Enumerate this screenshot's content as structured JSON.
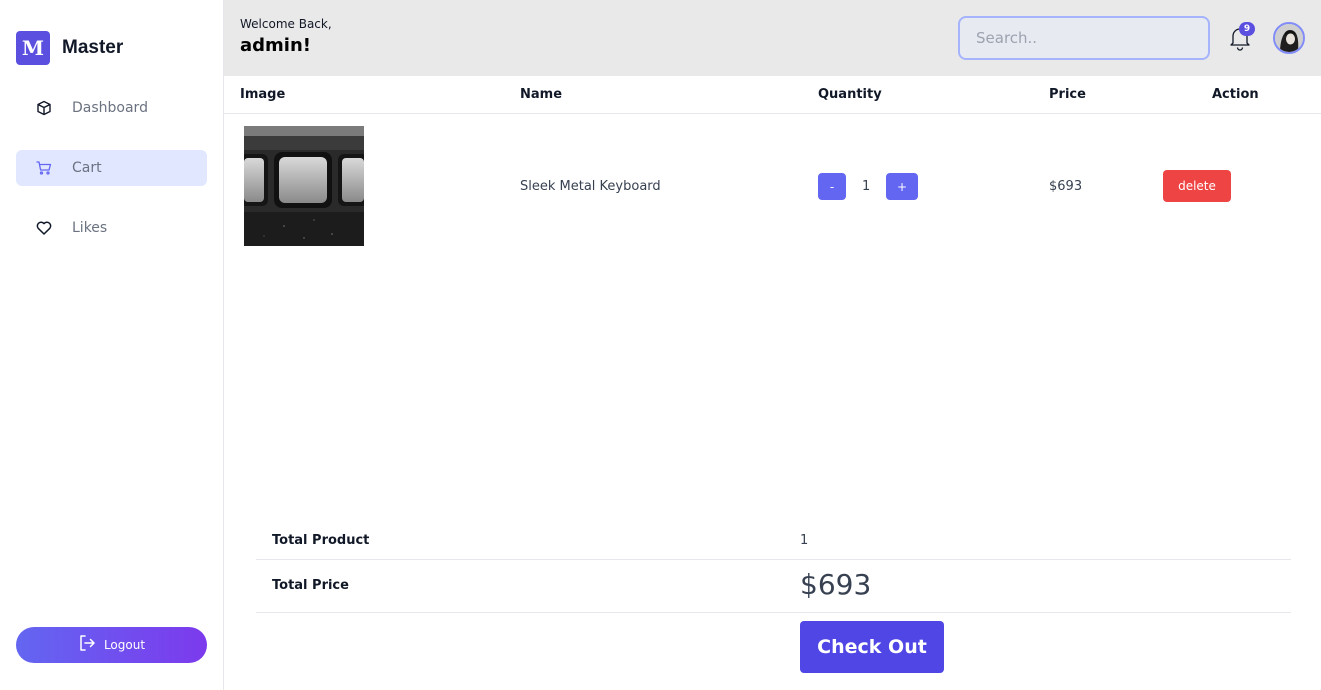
{
  "brand": {
    "logo_letter": "M",
    "name": "Master"
  },
  "sidebar": {
    "items": [
      {
        "label": "Dashboard",
        "icon": "cube-icon",
        "active": false
      },
      {
        "label": "Cart",
        "icon": "cart-icon",
        "active": true
      },
      {
        "label": "Likes",
        "icon": "heart-icon",
        "active": false
      }
    ],
    "logout_label": "Logout"
  },
  "header": {
    "welcome": "Welcome Back,",
    "username": "admin!",
    "search_placeholder": "Search..",
    "notification_count": "9"
  },
  "table": {
    "columns": [
      "Image",
      "Name",
      "Quantity",
      "Price",
      "Action"
    ],
    "rows": [
      {
        "name": "Sleek Metal Keyboard",
        "quantity": "1",
        "price": "$693",
        "decrement": "-",
        "increment": "+",
        "action": "delete"
      }
    ]
  },
  "summary": {
    "total_product_label": "Total Product",
    "total_product": "1",
    "total_price_label": "Total Price",
    "total_price": "$693",
    "checkout_label": "Check Out"
  },
  "colors": {
    "accent": "#6366f1",
    "brand": "#5b4fe0",
    "danger": "#ef4444",
    "active_nav_bg": "#e0e7ff"
  }
}
